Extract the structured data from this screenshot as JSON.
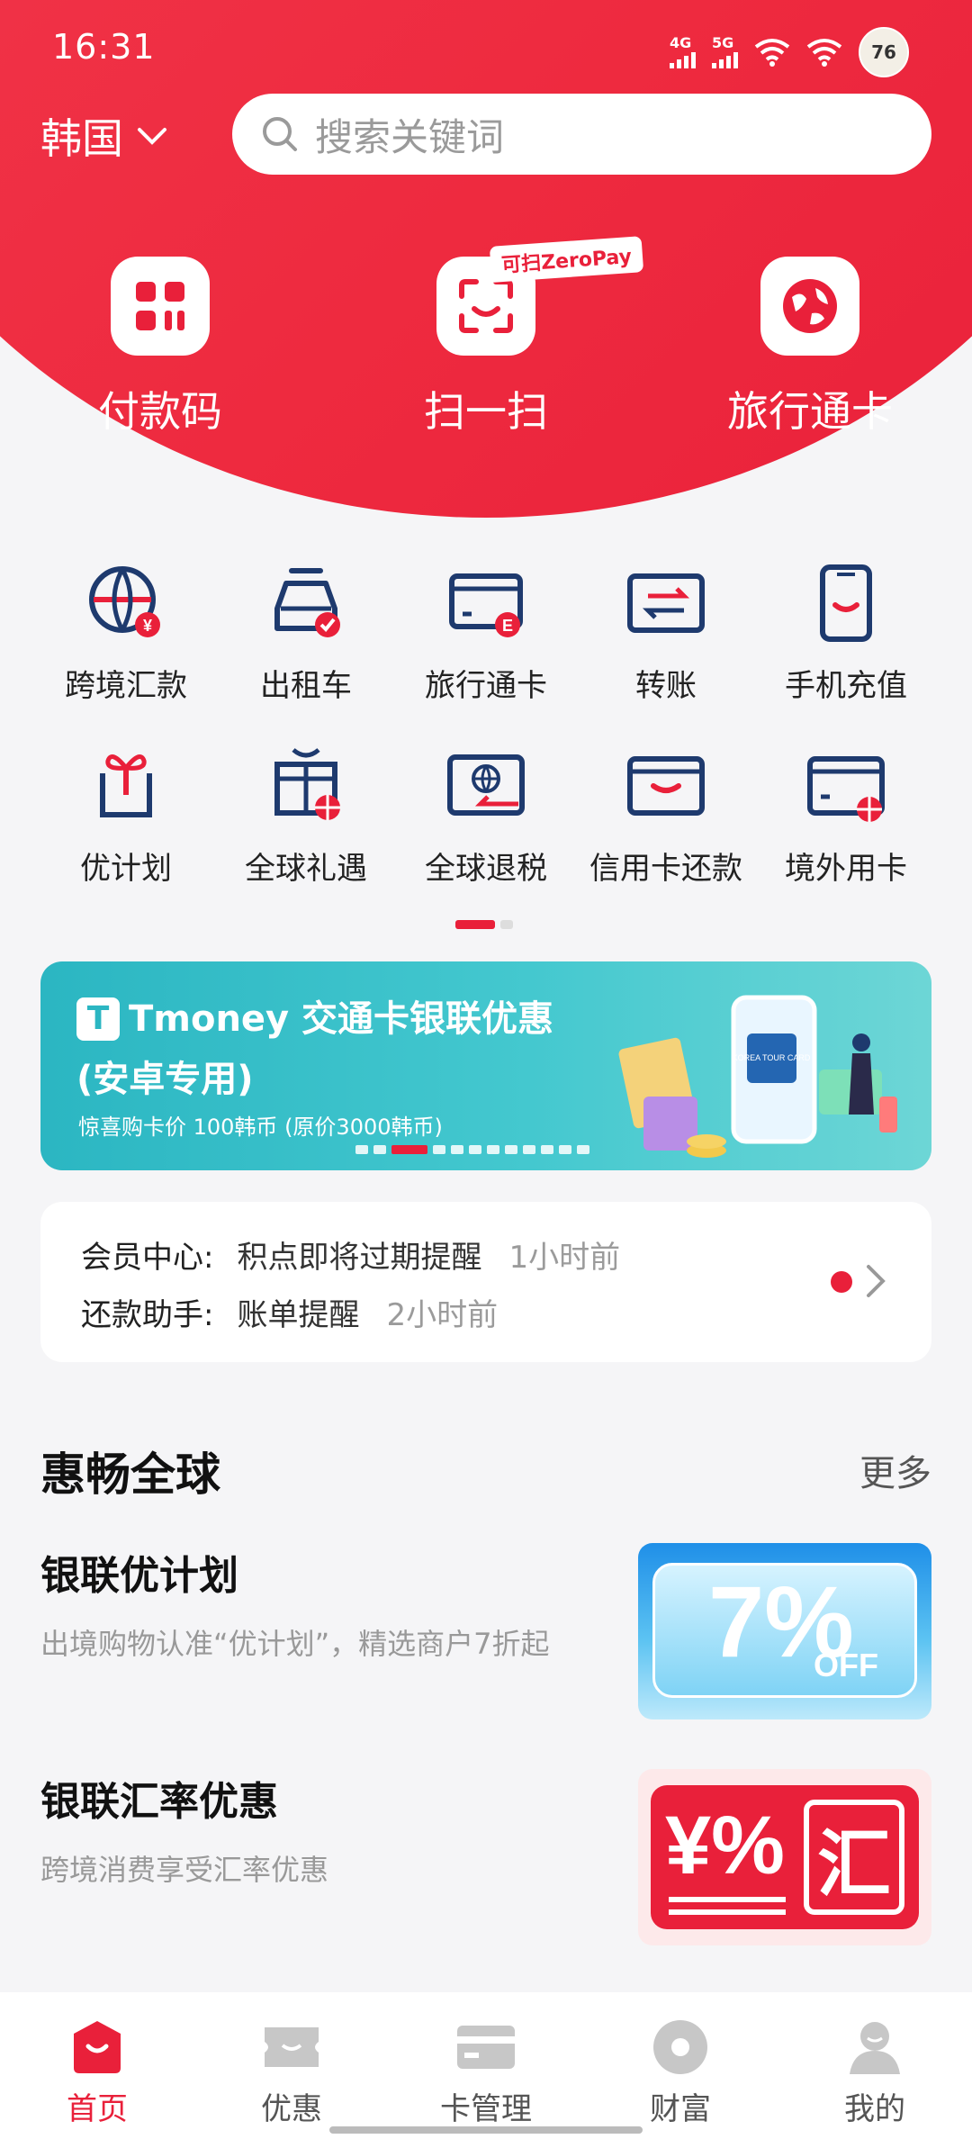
{
  "status_bar": {
    "time": "16:31",
    "net1": "4G",
    "net2": "5G",
    "avatar_text": "76"
  },
  "header": {
    "region": "韩国",
    "search_placeholder": "搜索关键词",
    "entries": [
      {
        "label": "付款码",
        "icon": "payment-code-icon"
      },
      {
        "label": "扫一扫",
        "icon": "scan-icon"
      },
      {
        "label": "旅行通卡",
        "icon": "travel-card-globe-icon"
      }
    ],
    "scan_tag": "可扫ZeroPay"
  },
  "grid": {
    "items": [
      {
        "label": "跨境汇款",
        "icon": "cross-border-remit-icon"
      },
      {
        "label": "出租车",
        "icon": "taxi-icon"
      },
      {
        "label": "旅行通卡",
        "icon": "travel-card-icon"
      },
      {
        "label": "转账",
        "icon": "transfer-icon"
      },
      {
        "label": "手机充值",
        "icon": "phone-topup-icon"
      },
      {
        "label": "优计划",
        "icon": "gift-plan-icon"
      },
      {
        "label": "全球礼遇",
        "icon": "global-gift-icon"
      },
      {
        "label": "全球退税",
        "icon": "tax-refund-icon"
      },
      {
        "label": "信用卡还款",
        "icon": "credit-repay-icon"
      },
      {
        "label": "境外用卡",
        "icon": "overseas-card-icon"
      }
    ]
  },
  "banner": {
    "logo": "T",
    "title": "Tmoney 交通卡银联优惠",
    "subtitle": "(安卓专用)",
    "price_text": "惊喜购卡价 100韩币 (原价3000韩币)",
    "card_text": "KOREA TOUR CARD"
  },
  "notices": [
    {
      "key": "会员中心:",
      "value": "积点即将过期提醒",
      "time": "1小时前"
    },
    {
      "key": "还款助手:",
      "value": "账单提醒",
      "time": "2小时前"
    }
  ],
  "section": {
    "title": "惠畅全球",
    "more": "更多",
    "promos": [
      {
        "title": "银联优计划",
        "desc": "出境购物认准“优计划”，精选商户7折起",
        "img_main": "7%",
        "img_sub": "OFF"
      },
      {
        "title": "银联汇率优惠",
        "desc": "跨境消费享受汇率优惠",
        "img_left": "¥%",
        "img_right": "汇"
      }
    ]
  },
  "bottom_nav": [
    {
      "label": "首页",
      "icon": "home-icon",
      "active": true
    },
    {
      "label": "优惠",
      "icon": "coupon-icon",
      "active": false
    },
    {
      "label": "卡管理",
      "icon": "card-manage-icon",
      "active": false
    },
    {
      "label": "财富",
      "icon": "wealth-icon",
      "active": false
    },
    {
      "label": "我的",
      "icon": "profile-icon",
      "active": false
    }
  ],
  "colors": {
    "brand_red": "#e9203a",
    "navy": "#1e3a6e",
    "teal": "#2bb6c2"
  }
}
